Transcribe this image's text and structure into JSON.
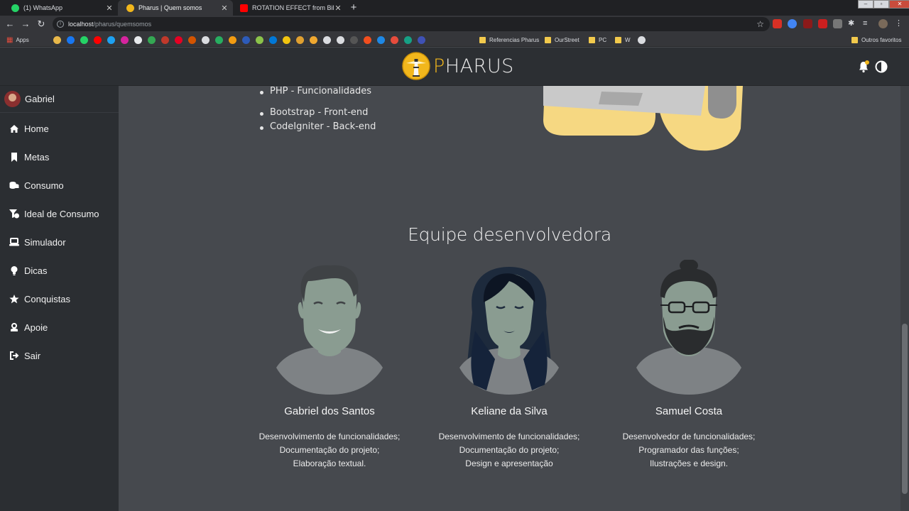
{
  "browser": {
    "tabs": [
      {
        "title": "(1) WhatsApp",
        "favicon": "whatsapp-icon",
        "color": "#25d366",
        "active": false
      },
      {
        "title": "Pharus | Quem somos",
        "favicon": "pharus-icon",
        "color": "#f2b71c",
        "active": true
      },
      {
        "title": "ROTATION EFFECT from Billie Eil...",
        "favicon": "youtube-icon",
        "color": "#ff0000",
        "active": false
      }
    ],
    "url_host": "localhost",
    "url_path": "/pharus/quemsomos",
    "bookmarks": {
      "apps_label": "Apps",
      "folders": [
        "Referencias Pharus",
        "OurStreet",
        "PC",
        "W"
      ],
      "other_label": "Outros favoritos"
    }
  },
  "header": {
    "logo_text_first": "P",
    "logo_text_rest": "HARUS",
    "accent_color": "#f2b71c"
  },
  "sidebar": {
    "user_name": "Gabriel",
    "items": [
      {
        "label": "Home",
        "icon": "home-icon"
      },
      {
        "label": "Metas",
        "icon": "bookmark-icon"
      },
      {
        "label": "Consumo",
        "icon": "coins-icon"
      },
      {
        "label": "Ideal de Consumo",
        "icon": "funnel-dollar-icon"
      },
      {
        "label": "Simulador",
        "icon": "laptop-icon"
      },
      {
        "label": "Dicas",
        "icon": "lightbulb-icon"
      },
      {
        "label": "Conquistas",
        "icon": "star-icon"
      },
      {
        "label": "Apoie",
        "icon": "hand-holding-icon"
      },
      {
        "label": "Sair",
        "icon": "sign-out-icon"
      }
    ]
  },
  "main": {
    "tech_list": [
      "PHP - Funcionalidades",
      "Bootstrap - Front-end",
      "CodeIgniter - Back-end"
    ],
    "team_title": "Equipe desenvolvedora",
    "team": [
      {
        "name": "Gabriel dos Santos",
        "roles": [
          "Desenvolvimento de funcionalidades;",
          "Documentação do projeto;",
          "Elaboração textual."
        ]
      },
      {
        "name": "Keliane da Silva",
        "roles": [
          "Desenvolvimento de funcionalidades;",
          "Documentação do projeto;",
          "Design e apresentação"
        ]
      },
      {
        "name": "Samuel Costa",
        "roles": [
          "Desenvolvedor de funcionalidades;",
          "Programador das funções;",
          "Ilustrações e design."
        ]
      }
    ]
  }
}
